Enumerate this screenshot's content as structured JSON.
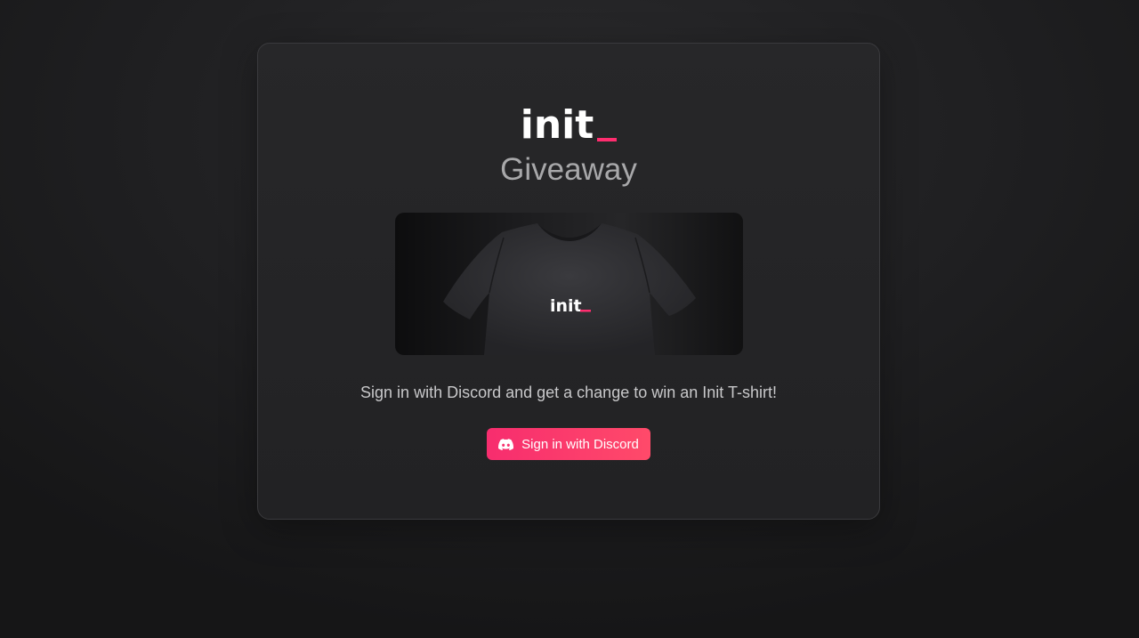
{
  "brand": {
    "wordmark": "init",
    "accent_color": "#ff2d6f"
  },
  "page": {
    "title": "Giveaway",
    "tagline": "Sign in with Discord and get a change to win an Init T-shirt!"
  },
  "product_image": {
    "icon": "tshirt-image",
    "print_wordmark": "init"
  },
  "actions": {
    "sign_in_label": "Sign in with Discord",
    "sign_in_icon": "discord-icon"
  }
}
